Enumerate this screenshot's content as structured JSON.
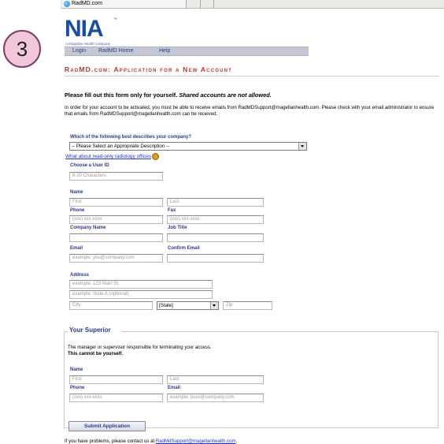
{
  "badge": "3",
  "browser": {
    "tab_title": "RadMD.com"
  },
  "logo": {
    "text": "NIA",
    "tm": "™",
    "subtitle": "A Magellan Health Company"
  },
  "nav": {
    "items": [
      "Login",
      "RadMD Home",
      "Help"
    ]
  },
  "heading": "RadMD.com: Application for a New Account",
  "warning": {
    "bold": "Please fill out this form only for yourself.",
    "italic": "Shared accounts are not allowed."
  },
  "intro": "In order for your account to be activated, you must be able to receive emails from RadMDSupport@magellanhealth.com. Please check with your email administrator to ensure that emails from RadMDSupport@magellanhealth.com can be received.",
  "company": {
    "label": "Which of the following best describes your company?",
    "selected": "-- Please Select an Appropriate Description --",
    "read_only_link": "What about read-only radiology offices"
  },
  "form": {
    "user_id": {
      "label": "Choose a User ID",
      "placeholder": "6-20 Characters"
    },
    "name": {
      "label": "Name",
      "first": "First",
      "last": "Last"
    },
    "phone": {
      "label": "Phone",
      "placeholder": "(xxx) xxx-xxxx"
    },
    "fax": {
      "label": "Fax",
      "placeholder": "(xxx) xxx-xxxx"
    },
    "company_name": {
      "label": "Company Name",
      "value": ""
    },
    "job_title": {
      "label": "Job Title",
      "value": ""
    },
    "email": {
      "label": "Email",
      "placeholder": "example: you@company.com"
    },
    "confirm_email": {
      "label": "Confirm Email",
      "value": ""
    },
    "address": {
      "label": "Address",
      "line1": "example: 123 Main St.",
      "line2": "example: Suite A (optional)",
      "city": "City",
      "state": "[State]",
      "zip": "Zip"
    }
  },
  "superior": {
    "legend": "Your Superior",
    "text": "The manager or supervisor responsible for terminating your access.",
    "text_bold": "This cannot be yourself.",
    "name_label": "Name",
    "first": "First",
    "last": "Last",
    "phone_label": "Phone",
    "phone_placeholder": "(xxx) xxx-xxxx",
    "email_label": "Email",
    "email_placeholder": "example: boss@company.com"
  },
  "submit_label": "Submit Application",
  "footer": {
    "text": "If you have problems, please contact us at ",
    "link": "RadMdSupport@magellanhealth.com",
    "end": "."
  }
}
